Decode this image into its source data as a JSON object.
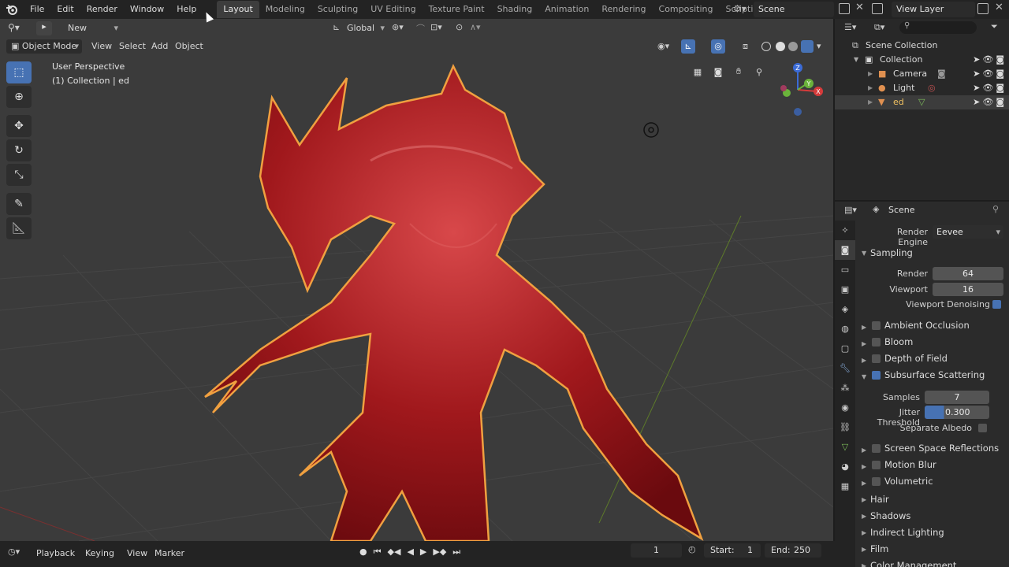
{
  "menu": [
    "File",
    "Edit",
    "Render",
    "Window",
    "Help"
  ],
  "workspaces": [
    "Layout",
    "Modeling",
    "Sculpting",
    "UV Editing",
    "Texture Paint",
    "Shading",
    "Animation",
    "Rendering",
    "Compositing",
    "Scripting"
  ],
  "active_workspace": "Layout",
  "scene_name": "Scene",
  "view_layer": "View Layer",
  "viewport": {
    "new_label": "New",
    "orientation": "Global",
    "mode": "Object Mode",
    "menus": [
      "View",
      "Select",
      "Add",
      "Object"
    ],
    "info_line1": "User Perspective",
    "info_line2": "(1) Collection | ed",
    "gizmo_axes": [
      "X",
      "Y",
      "Z"
    ]
  },
  "timeline": {
    "menus": [
      "Playback",
      "Keying",
      "View",
      "Marker"
    ],
    "current_frame": "1",
    "start_label": "Start:",
    "start": "1",
    "end_label": "End:",
    "end": "250"
  },
  "outliner": {
    "root": "Scene Collection",
    "collection": "Collection",
    "items": [
      "Camera",
      "Light",
      "ed"
    ]
  },
  "properties": {
    "context": "Scene",
    "render_engine_label": "Render Engine",
    "render_engine": "Eevee",
    "sampling": {
      "title": "Sampling",
      "render_label": "Render",
      "render": "64",
      "viewport_label": "Viewport",
      "viewport": "16",
      "denoise_label": "Viewport Denoising"
    },
    "panels": [
      "Ambient Occlusion",
      "Bloom",
      "Depth of Field"
    ],
    "sss": {
      "title": "Subsurface Scattering",
      "samples_label": "Samples",
      "samples": "7",
      "jitter_label": "Jitter Threshold",
      "jitter": "0.300",
      "albedo_label": "Separate Albedo"
    },
    "panels2": [
      "Screen Space Reflections",
      "Motion Blur",
      "Volumetric"
    ],
    "panels3": [
      "Hair",
      "Shadows",
      "Indirect Lighting",
      "Film",
      "Color Management"
    ]
  },
  "colors": {
    "accent": "#4772b3",
    "model_red": "#b0201f",
    "outline": "#f0a040"
  }
}
